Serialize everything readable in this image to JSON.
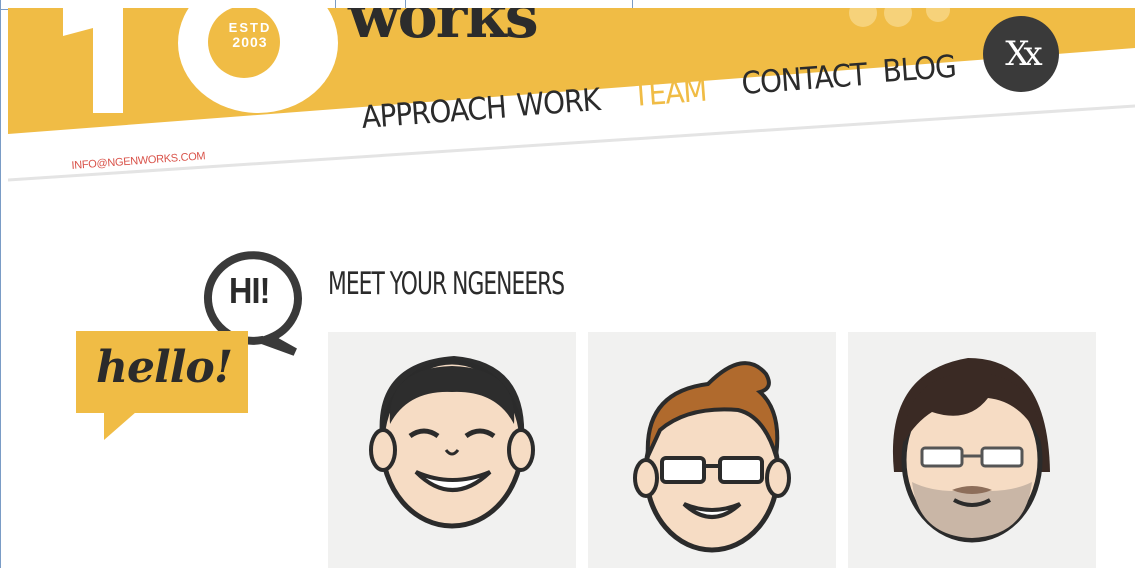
{
  "header": {
    "brand_suffix": "works",
    "estd_line1": "ESTD",
    "estd_line2": "2003",
    "email": "INFO@NGENWORKS.COM",
    "logo_badge": "Xx",
    "nav": [
      {
        "label": "APPROACH",
        "active": false
      },
      {
        "label": "WORK",
        "active": false
      },
      {
        "label": "TEAM",
        "active": true
      },
      {
        "label": "CONTACT",
        "active": false
      },
      {
        "label": "BLOG",
        "active": false
      }
    ]
  },
  "team": {
    "title": "MEET YOUR NGENEERS",
    "hello": "hello!",
    "hi": "HI!",
    "members": [
      {
        "avatar": "smiling-man-avatar"
      },
      {
        "avatar": "glasses-man-avatar"
      },
      {
        "avatar": "bearded-man-avatar"
      }
    ]
  },
  "colors": {
    "accent": "#f0bc45",
    "text": "#2b2b2b",
    "email": "#d9534a",
    "card_bg": "#f1f1f0"
  }
}
